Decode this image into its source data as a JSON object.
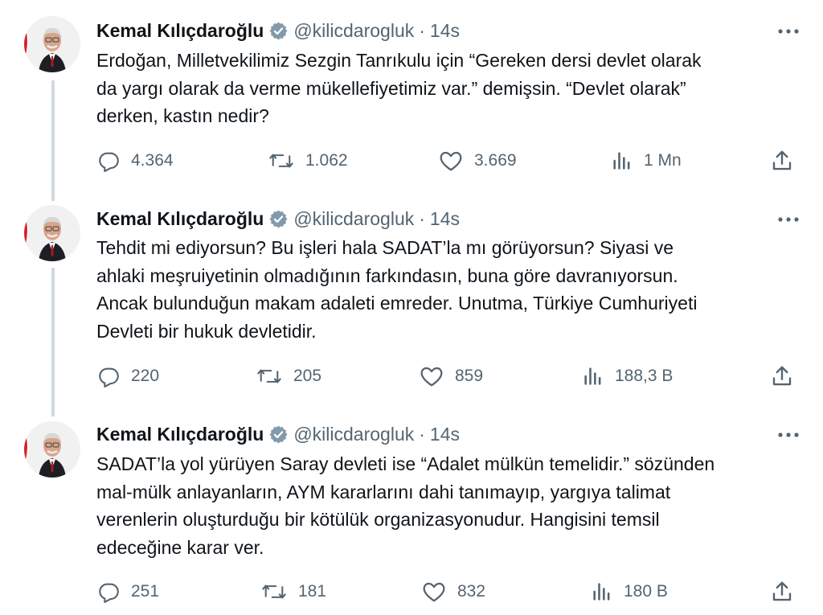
{
  "tweets": [
    {
      "author_name": "Kemal Kılıçdaroğlu",
      "handle": "@kilicdarogluk",
      "separator": "·",
      "time": "14s",
      "text_lines": [
        "Erdoğan, Milletvekilimiz Sezgin Tanrıkulu için “Gereken dersi devlet olarak",
        "da yargı olarak da verme mükellefiyetimiz var.” demişsin. “Devlet olarak”",
        "derken, kastın nedir?"
      ],
      "replies": "4.364",
      "retweets": "1.062",
      "likes": "3.669",
      "views": "1 Mn"
    },
    {
      "author_name": "Kemal Kılıçdaroğlu",
      "handle": "@kilicdarogluk",
      "separator": "·",
      "time": "14s",
      "text_lines": [
        "Tehdit mi ediyorsun? Bu işleri hala SADAT’la mı görüyorsun? Siyasi ve",
        "ahlaki meşruiyetinin olmadığının farkındasın, buna göre davranıyorsun.",
        "Ancak bulunduğun makam adaleti emreder. Unutma, Türkiye Cumhuriyeti",
        "Devleti bir hukuk devletidir."
      ],
      "replies": "220",
      "retweets": "205",
      "likes": "859",
      "views": "188,3 B"
    },
    {
      "author_name": "Kemal Kılıçdaroğlu",
      "handle": "@kilicdarogluk",
      "separator": "·",
      "time": "14s",
      "text_lines": [
        "SADAT’la yol yürüyen Saray devleti ise “Adalet mülkün temelidir.” sözünden",
        "mal-mülk anlayanların, AYM kararlarını dahi tanımayıp, yargıya talimat",
        "verenlerin oluşturduğu bir kötülük organizasyonudur. Hangisini temsil",
        "edeceğine karar ver."
      ],
      "replies": "251",
      "retweets": "181",
      "likes": "832",
      "views": "180 B"
    }
  ],
  "icons": {
    "avatar": "avatar-photo",
    "verified": "verified-badge-icon",
    "more": "more-options-icon",
    "reply": "reply-icon",
    "retweet": "retweet-icon",
    "like": "like-icon",
    "views": "views-icon",
    "share": "share-icon"
  },
  "colors": {
    "text": "#0f1419",
    "secondary": "#536471",
    "thread_line": "#cfd9de",
    "verified_badge": "#829aab"
  }
}
